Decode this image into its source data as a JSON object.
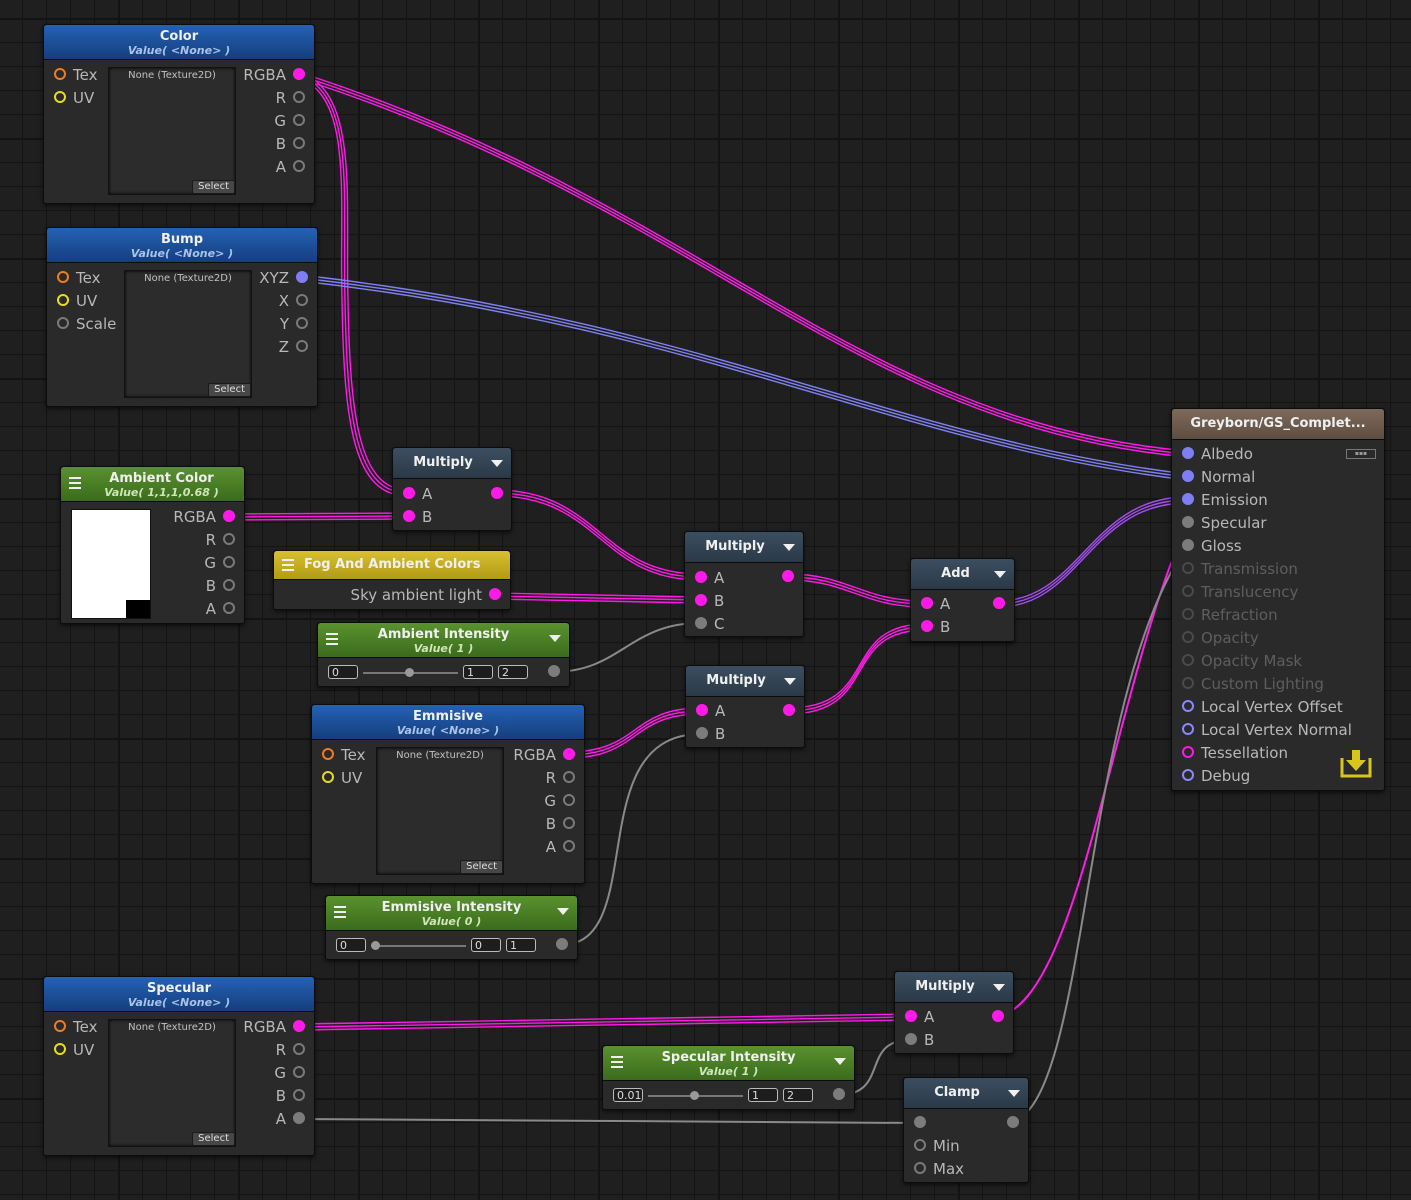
{
  "colors": {
    "magenta": "#ff1ae8",
    "purple": "#7e7ef5",
    "grey_wire": "#8a8a8a",
    "blue_header": "#1f56a8",
    "green_header": "#4e8228",
    "yellow_header": "#c9b020"
  },
  "nodes": {
    "color": {
      "title": "Color",
      "subtitle": "Value( <None> )",
      "inputs": [
        "Tex",
        "UV"
      ],
      "outputs": [
        "RGBA",
        "R",
        "G",
        "B",
        "A"
      ],
      "texture": "None (Texture2D)",
      "select": "Select"
    },
    "bump": {
      "title": "Bump",
      "subtitle": "Value( <None> )",
      "inputs": [
        "Tex",
        "UV",
        "Scale"
      ],
      "outputs": [
        "XYZ",
        "X",
        "Y",
        "Z"
      ],
      "texture": "None (Texture2D)",
      "select": "Select"
    },
    "ambient_color": {
      "title": "Ambient Color",
      "subtitle": "Value( 1,1,1,0.68 )",
      "outputs": [
        "RGBA",
        "R",
        "G",
        "B",
        "A"
      ]
    },
    "fog": {
      "title": "Fog And Ambient Colors",
      "output": "Sky ambient light"
    },
    "ambient_intensity": {
      "title": "Ambient Intensity",
      "subtitle": "Value( 1 )",
      "min": "0",
      "value": "1",
      "max": "2",
      "value_fraction": 0.5
    },
    "emmisive": {
      "title": "Emmisive",
      "subtitle": "Value( <None> )",
      "inputs": [
        "Tex",
        "UV"
      ],
      "outputs": [
        "RGBA",
        "R",
        "G",
        "B",
        "A"
      ],
      "texture": "None (Texture2D)",
      "select": "Select"
    },
    "emmisive_intensity": {
      "title": "Emmisive Intensity",
      "subtitle": "Value( 0 )",
      "min": "0",
      "value": "0",
      "max": "1",
      "value_fraction": 0.0
    },
    "specular": {
      "title": "Specular",
      "subtitle": "Value( <None> )",
      "inputs": [
        "Tex",
        "UV"
      ],
      "outputs": [
        "RGBA",
        "R",
        "G",
        "B",
        "A"
      ],
      "texture": "None (Texture2D)",
      "select": "Select"
    },
    "specular_intensity": {
      "title": "Specular Intensity",
      "subtitle": "Value( 1 )",
      "min": "0.01",
      "value": "1",
      "max": "2",
      "value_fraction": 0.5
    },
    "multiply1": {
      "title": "Multiply",
      "inputs": [
        "A",
        "B"
      ]
    },
    "multiply2": {
      "title": "Multiply",
      "inputs": [
        "A",
        "B",
        "C"
      ]
    },
    "multiply3": {
      "title": "Multiply",
      "inputs": [
        "A",
        "B"
      ]
    },
    "multiply4": {
      "title": "Multiply",
      "inputs": [
        "A",
        "B"
      ]
    },
    "add": {
      "title": "Add",
      "inputs": [
        "A",
        "B"
      ]
    },
    "clamp": {
      "title": "Clamp",
      "inputs": [
        "",
        "Min",
        "Max"
      ]
    },
    "output": {
      "title": "Greyborn/GS_Complet...",
      "inputs": [
        "Albedo",
        "Normal",
        "Emission",
        "Specular",
        "Gloss",
        "Transmission",
        "Translucency",
        "Refraction",
        "Opacity",
        "Opacity Mask",
        "Custom Lighting",
        "Local Vertex Offset",
        "Local Vertex Normal",
        "Tessellation",
        "Debug"
      ]
    }
  }
}
